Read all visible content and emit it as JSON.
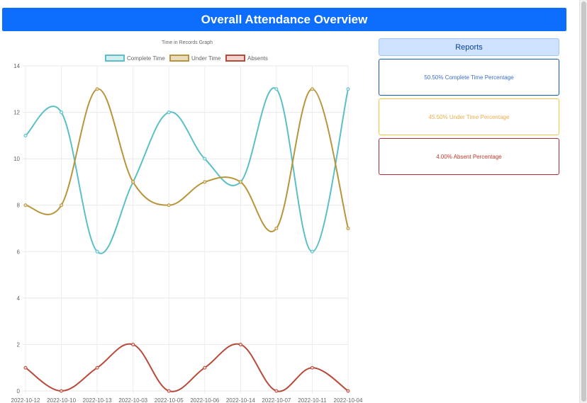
{
  "header": {
    "title": "Overall Attendance Overview"
  },
  "reports": {
    "title": "Reports",
    "cards": [
      {
        "text": "50.50% Complete Time Percentage",
        "color": "#3f6fc8",
        "border": "#0d5bbd"
      },
      {
        "text": "45.50% Under Time Percentage",
        "color": "#f0ad4e",
        "border": "#f5c542"
      },
      {
        "text": "4.00% Absent Percentage",
        "color": "#c0392b",
        "border": "#b02a37"
      }
    ]
  },
  "chart_data": {
    "type": "line",
    "title": "Time in Records Graph",
    "categories": [
      "2022-10-12",
      "2022-10-10",
      "2022-10-13",
      "2022-10-03",
      "2022-10-05",
      "2022-10-06",
      "2022-10-14",
      "2022-10-07",
      "2022-10-11",
      "2022-10-04"
    ],
    "series": [
      {
        "name": "Complete Time",
        "color": "#5bc0c6",
        "fill": "#d4eef0",
        "values": [
          11,
          12,
          6,
          9,
          12,
          10,
          9,
          13,
          6,
          13
        ]
      },
      {
        "name": "Under Time",
        "color": "#b8953a",
        "fill": "#e8ddc0",
        "values": [
          8,
          8,
          13,
          9,
          8,
          9,
          9,
          7,
          13,
          7
        ]
      },
      {
        "name": "Absents",
        "color": "#b84a3a",
        "fill": "#f0d4d0",
        "values": [
          1,
          0,
          1,
          2,
          0,
          1,
          2,
          0,
          1,
          0
        ]
      }
    ],
    "ylim": [
      0,
      14
    ],
    "yticks": [
      0,
      2,
      4,
      6,
      8,
      10,
      12,
      14
    ],
    "grid": true,
    "legend": "top"
  }
}
